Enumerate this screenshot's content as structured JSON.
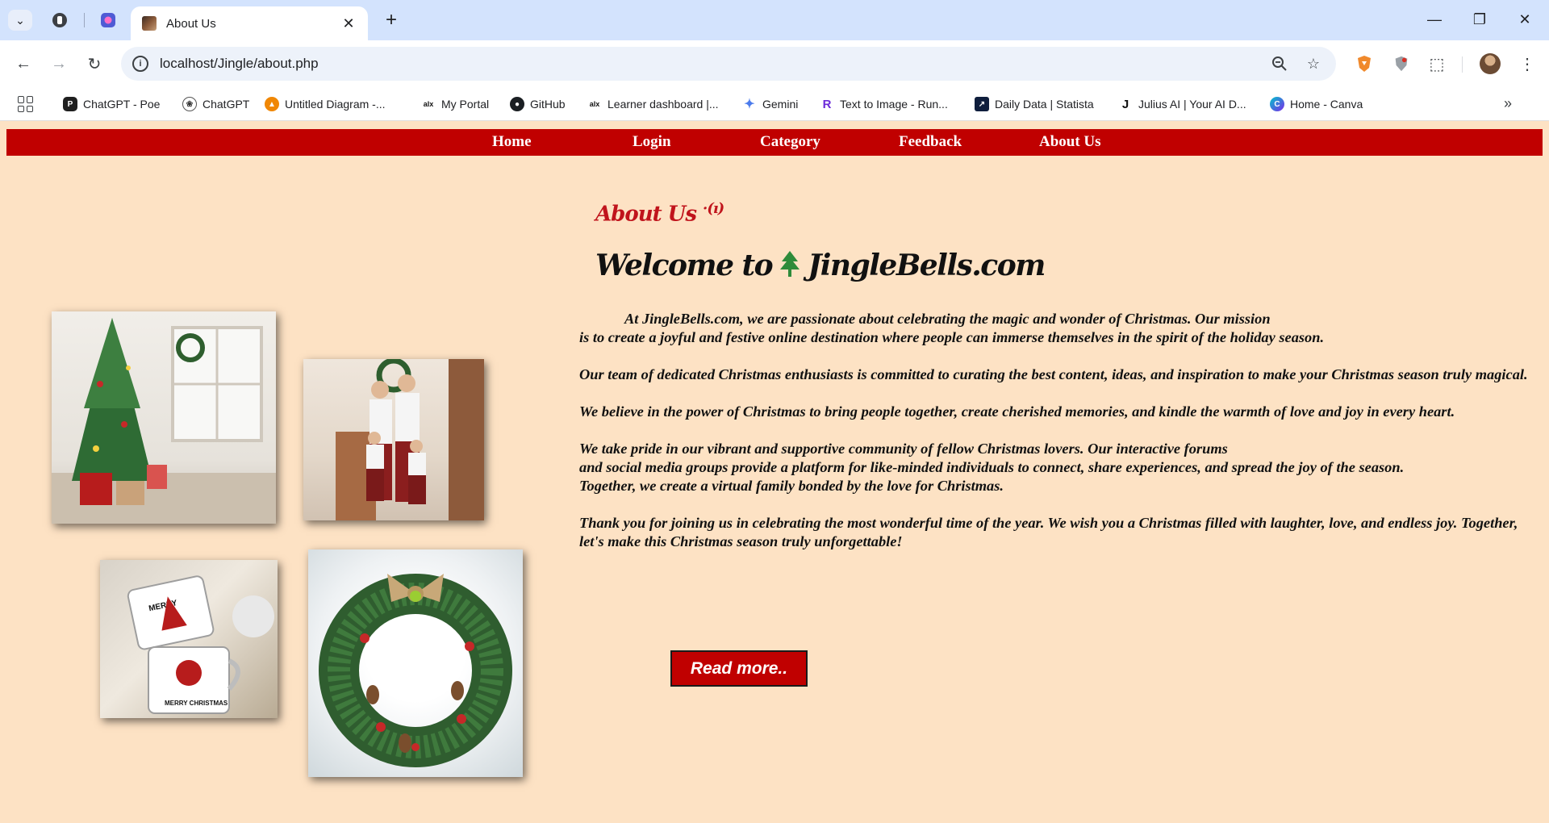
{
  "browser": {
    "tab_title": "About Us",
    "url": "localhost/Jingle/about.php",
    "bookmarks": [
      {
        "label": "ChatGPT - Poe",
        "icon": "poe-icon"
      },
      {
        "label": "ChatGPT",
        "icon": "openai-icon"
      },
      {
        "label": "Untitled Diagram -...",
        "icon": "drawio-icon"
      },
      {
        "label": "My Portal",
        "icon": "alx-icon"
      },
      {
        "label": "GitHub",
        "icon": "github-icon"
      },
      {
        "label": "Learner dashboard |...",
        "icon": "alx-icon"
      },
      {
        "label": "Gemini",
        "icon": "gemini-icon"
      },
      {
        "label": "Text to Image - Run...",
        "icon": "runway-icon"
      },
      {
        "label": "Daily Data | Statista",
        "icon": "statista-icon"
      },
      {
        "label": "Julius AI | Your AI D...",
        "icon": "julius-icon"
      },
      {
        "label": "Home - Canva",
        "icon": "canva-icon"
      }
    ]
  },
  "nav": {
    "items": [
      "Home",
      "Login",
      "Category",
      "Feedback",
      "About Us"
    ]
  },
  "about": {
    "heading_small": "About Us",
    "heading_welcome_prefix": "Welcome to",
    "heading_welcome_site": "JingleBells.com",
    "paragraphs": [
      "At JingleBells.com, we are passionate about celebrating the magic and wonder of Christmas. Our mission",
      "is to create a joyful and festive online destination where people can immerse themselves in the spirit of the holiday season.",
      "Our team of dedicated Christmas enthusiasts is committed to curating the best content, ideas, and inspiration to make your Christmas season truly magical.",
      "We believe in the power of Christmas to bring people together, create cherished memories, and kindle the warmth of love and joy in every heart.",
      "We take pride in our vibrant and supportive community of fellow Christmas lovers. Our interactive forums",
      "and social media groups provide a platform for like-minded individuals to connect, share experiences, and spread the joy of the season.",
      "Together, we create a virtual family bonded by the love for Christmas.",
      "Thank you for joining us in celebrating the most wonderful time of the year. We wish you a Christmas filled with laughter, love, and endless joy. Together, let's make this Christmas season truly unforgettable!"
    ],
    "read_more": "Read more.."
  },
  "colors": {
    "page_bg": "#fde2c4",
    "nav_bg": "#c00000",
    "accent_red": "#c0141c"
  }
}
